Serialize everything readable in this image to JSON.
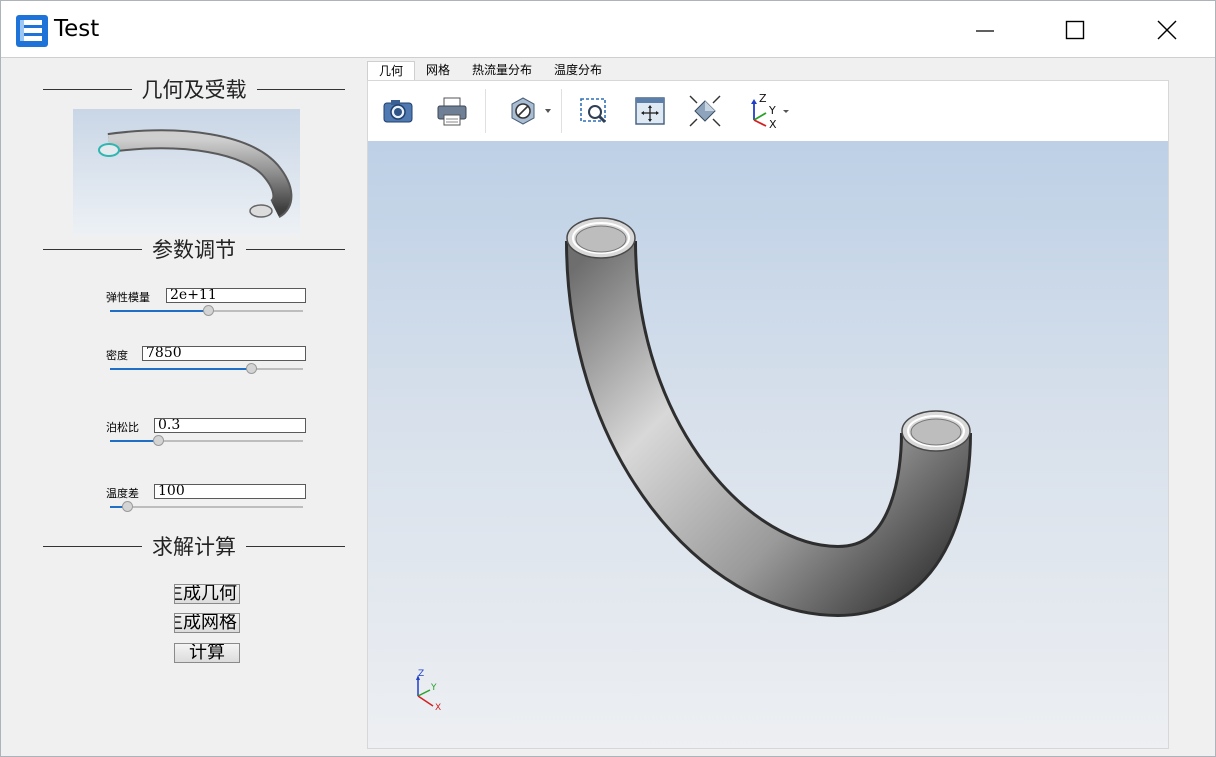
{
  "window": {
    "title": "Test"
  },
  "sidebar": {
    "sections": {
      "geometry": "几何及受载",
      "params": "参数调节",
      "solve": "求解计算"
    },
    "params": [
      {
        "label": "弹性模量",
        "value": "2e+11",
        "slider_fraction": 0.51
      },
      {
        "label": "密度",
        "value": "7850",
        "slider_fraction": 0.73
      },
      {
        "label": "泊松比",
        "value": "0.3",
        "slider_fraction": 0.25
      },
      {
        "label": "温度差",
        "value": "100",
        "slider_fraction": 0.09
      }
    ],
    "buttons": {
      "gen_geometry": "生成几何",
      "gen_mesh": "生成网格",
      "compute": "计算"
    }
  },
  "tabs": [
    "几何",
    "网格",
    "热流量分布",
    "温度分布"
  ],
  "active_tab": "几何",
  "toolbar": {
    "icons": [
      "camera-icon",
      "print-icon",
      "section-icon",
      "zoom-box-icon",
      "fit-all-icon",
      "projection-icon",
      "axis-triad-icon"
    ]
  },
  "viewer": {
    "triad_labels": {
      "x": "X",
      "y": "Y",
      "z": "Z"
    }
  },
  "colors": {
    "accent": "#1f6fc7",
    "app_icon": "#1e73d9",
    "triad_x": "#d21f1f",
    "triad_y": "#27a327",
    "triad_z": "#1f3fc7"
  }
}
